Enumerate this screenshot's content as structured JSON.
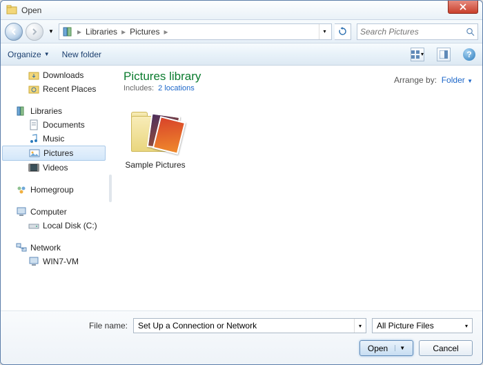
{
  "titlebar": {
    "title": "Open"
  },
  "nav": {
    "breadcrumb": [
      "Libraries",
      "Pictures"
    ],
    "search_placeholder": "Search Pictures"
  },
  "toolbar": {
    "organize": "Organize",
    "newfolder": "New folder"
  },
  "sidebar": {
    "downloads": "Downloads",
    "recent": "Recent Places",
    "libraries": "Libraries",
    "documents": "Documents",
    "music": "Music",
    "pictures": "Pictures",
    "videos": "Videos",
    "homegroup": "Homegroup",
    "computer": "Computer",
    "localdisk": "Local Disk (C:)",
    "network": "Network",
    "win7vm": "WIN7-VM"
  },
  "content": {
    "title": "Pictures library",
    "includes_label": "Includes:",
    "includes_link": "2 locations",
    "arrange_label": "Arrange by:",
    "arrange_value": "Folder",
    "items": [
      {
        "label": "Sample Pictures"
      }
    ]
  },
  "footer": {
    "filename_label": "File name:",
    "filename_value": "Set Up a Connection or Network",
    "filter": "All Picture Files",
    "open": "Open",
    "cancel": "Cancel"
  }
}
